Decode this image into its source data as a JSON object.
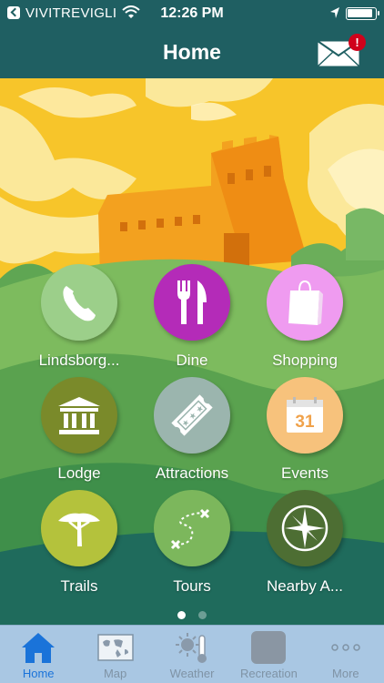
{
  "status_bar": {
    "carrier": "VIVITREVIGLI",
    "time": "12:26 PM"
  },
  "nav": {
    "title": "Home",
    "notification_badge": "!"
  },
  "tiles": [
    {
      "label": "Lindsborg...",
      "icon": "phone-icon",
      "color": "#9ccf8a"
    },
    {
      "label": "Dine",
      "icon": "fork-knife-icon",
      "color": "#b42bb8"
    },
    {
      "label": "Shopping",
      "icon": "shopping-bag-icon",
      "color": "#ef9bf0"
    },
    {
      "label": "Lodge",
      "icon": "bank-building-icon",
      "color": "#7a8a2a"
    },
    {
      "label": "Attractions",
      "icon": "ticket-icon",
      "color": "#9bb5ae"
    },
    {
      "label": "Events",
      "icon": "calendar-icon",
      "color": "#f7c27c",
      "calendar_day": "31"
    },
    {
      "label": "Trails",
      "icon": "tree-icon",
      "color": "#b4c23c"
    },
    {
      "label": "Tours",
      "icon": "route-map-icon",
      "color": "#7cb75c"
    },
    {
      "label": "Nearby A...",
      "icon": "compass-icon",
      "color": "#4d6e33"
    }
  ],
  "pagination": {
    "current": 1,
    "total": 2
  },
  "tab_bar": [
    {
      "label": "Home",
      "icon": "home-icon",
      "active": true
    },
    {
      "label": "Map",
      "icon": "world-map-icon",
      "active": false
    },
    {
      "label": "Weather",
      "icon": "weather-icon",
      "active": false
    },
    {
      "label": "Recreation",
      "icon": "recreation-icon",
      "active": false
    },
    {
      "label": "More",
      "icon": "more-icon",
      "active": false
    }
  ],
  "colors": {
    "nav_bar": "#1f5f62",
    "tab_bar": "#a9c7e3",
    "tab_active": "#1a73d9",
    "badge": "#d0021b"
  }
}
